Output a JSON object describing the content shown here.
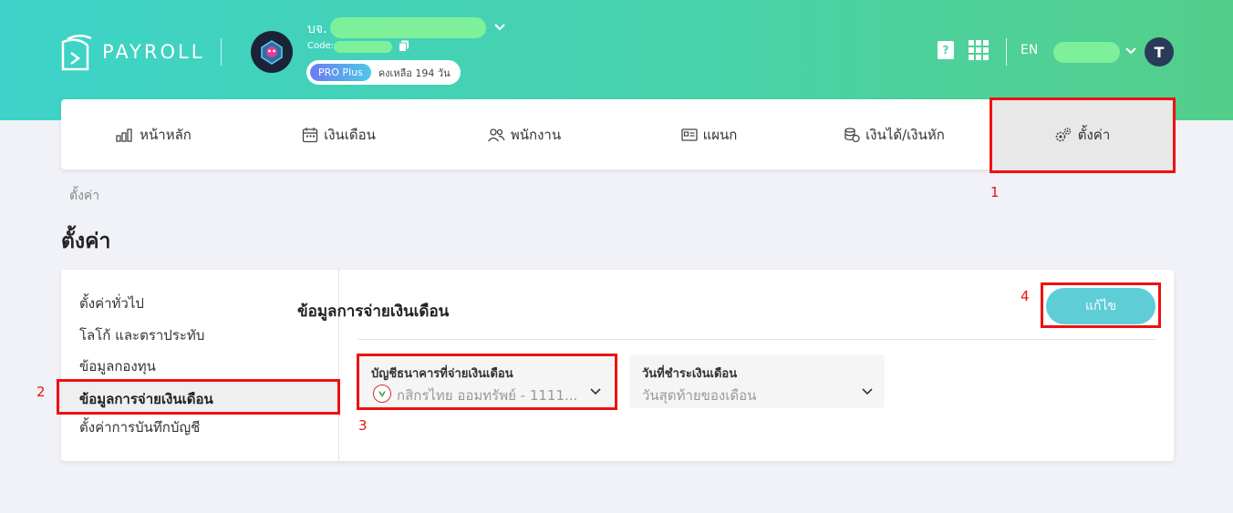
{
  "app": {
    "logo_text": "PAYROLL"
  },
  "company": {
    "prefix": "บจ.",
    "code_label": "Code:",
    "plan_badge": "PRO Plus",
    "plan_days": "คงเหลือ 194 วัน"
  },
  "header": {
    "language": "EN",
    "user_initial": "T",
    "icons": [
      "help-book-icon",
      "apps-grid-icon",
      "chevron-down-icon"
    ]
  },
  "nav": {
    "items": [
      {
        "label": "หน้าหลัก",
        "icon": "bar-chart-icon"
      },
      {
        "label": "เงินเดือน",
        "icon": "calendar-icon"
      },
      {
        "label": "พนักงาน",
        "icon": "users-icon"
      },
      {
        "label": "แผนก",
        "icon": "id-card-icon"
      },
      {
        "label": "เงินได้/เงินหัก",
        "icon": "coins-icon"
      },
      {
        "label": "ตั้งค่า",
        "icon": "gears-icon",
        "active": true
      }
    ]
  },
  "breadcrumb": "ตั้งค่า",
  "page_title": "ตั้งค่า",
  "sidebar": {
    "items": [
      {
        "label": "ตั้งค่าทั่วไป"
      },
      {
        "label": "โลโก้ และตราประทับ"
      },
      {
        "label": "ข้อมูลกองทุน"
      },
      {
        "label": "ข้อมูลการจ่ายเงินเดือน",
        "active": true
      },
      {
        "label": "ตั้งค่าการบันทึกบัญชี"
      }
    ]
  },
  "section": {
    "title": "ข้อมูลการจ่ายเงินเดือน",
    "edit_label": "แก้ไข",
    "fields": [
      {
        "label": "บัญชีธนาคารที่จ่ายเงินเดือน",
        "value": "กสิกรไทย ออมทรัพย์ - 1111..."
      },
      {
        "label": "วันที่ชำระเงินเดือน",
        "value": "วันสุดท้ายของเดือน"
      }
    ]
  },
  "annotations": [
    "1",
    "2",
    "3",
    "4"
  ],
  "colors": {
    "header_start": "#3dd3c8",
    "header_end": "#53cf8a",
    "accent_button": "#5ecdd6",
    "highlight": "#ee1111"
  }
}
